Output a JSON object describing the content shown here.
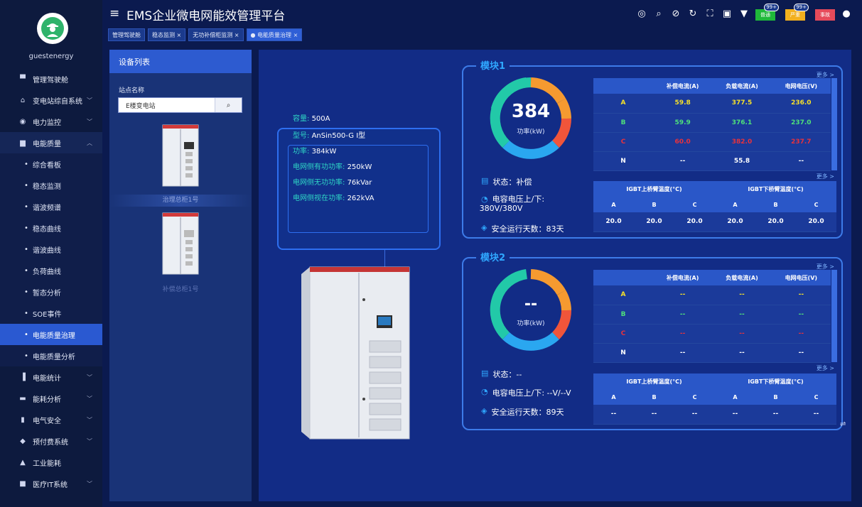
{
  "user": {
    "name": "guestenergy"
  },
  "app": {
    "title": "EMS企业微电网能效管理平台"
  },
  "tabs": [
    {
      "label": "管理驾驶舱"
    },
    {
      "label": "稳态监测 ×"
    },
    {
      "label": "无功补偿柜监测 ×"
    },
    {
      "label": "● 电能质量治理 ×"
    }
  ],
  "alarms": {
    "normal": {
      "label": "普通",
      "count": "99+",
      "color": "#1fb83a"
    },
    "severe": {
      "label": "严重",
      "count": "99+",
      "color": "#f2b01e"
    },
    "fault": {
      "label": "事故",
      "color": "#e64a5a"
    }
  },
  "sidebar": {
    "items": [
      {
        "label": "管理驾驶舱",
        "icon": "monitor-icon"
      },
      {
        "label": "变电站综自系统",
        "icon": "home-icon"
      },
      {
        "label": "电力监控",
        "icon": "gauge-icon"
      },
      {
        "label": "电能质量",
        "icon": "folder-icon"
      }
    ],
    "sub": [
      {
        "label": "综合看板"
      },
      {
        "label": "稳态监测"
      },
      {
        "label": "谐波频谱"
      },
      {
        "label": "稳态曲线"
      },
      {
        "label": "谐波曲线"
      },
      {
        "label": "负荷曲线"
      },
      {
        "label": "暂态分析"
      },
      {
        "label": "SOE事件"
      },
      {
        "label": "电能质量治理"
      },
      {
        "label": "电能质量分析"
      }
    ],
    "bottom": [
      {
        "label": "电能统计",
        "icon": "bar-chart-icon"
      },
      {
        "label": "能耗分析",
        "icon": "analysis-icon"
      },
      {
        "label": "电气安全",
        "icon": "fire-extinguisher-icon"
      },
      {
        "label": "预付费系统",
        "icon": "prepay-icon"
      },
      {
        "label": "工业能耗",
        "icon": "factory-icon"
      },
      {
        "label": "医疗IT系统",
        "icon": "medical-icon"
      }
    ]
  },
  "device_panel": {
    "title": "设备列表",
    "site_label": "站点名称",
    "site_value": "E楼变电站",
    "devices": [
      {
        "label": "治理总柜1号"
      },
      {
        "label": "补偿总柜1号"
      }
    ]
  },
  "device_info": {
    "capacity_k": "容量:",
    "capacity_v": "500A",
    "model_k": "型号:",
    "model_v": "AnSin500-G I型",
    "power_k": "功率:",
    "power_v": "384kW",
    "active_k": "电网侧有功功率:",
    "active_v": "250kW",
    "reactive_k": "电网侧无功功率:",
    "reactive_v": "76kVar",
    "apparent_k": "电网侧视在功率:",
    "apparent_v": "262kVA"
  },
  "modules": [
    {
      "title": "模块1",
      "more": "更多 >",
      "power": "384",
      "power_unit": "功率(kW)",
      "status": "状态：补偿",
      "cap_voltage_1": "电容电压上/下:",
      "cap_voltage_2": "380V/380V",
      "safe_days": "安全运行天数：83天",
      "table_headers": [
        "",
        "补偿电流(A)",
        "负载电流(A)",
        "电网电压(V)"
      ],
      "rows": [
        {
          "phase": "A",
          "comp": "59.8",
          "load": "377.5",
          "volt": "236.0",
          "color": "#f5e02a"
        },
        {
          "phase": "B",
          "comp": "59.9",
          "load": "376.1",
          "volt": "237.0",
          "color": "#4fe07a"
        },
        {
          "phase": "C",
          "comp": "60.0",
          "load": "382.0",
          "volt": "237.7",
          "color": "#e8323c"
        },
        {
          "phase": "N",
          "comp": "--",
          "load": "55.8",
          "volt": "--",
          "color": "#ffffff"
        }
      ],
      "igbt_more": "更多 >",
      "igbt_up": "IGBT上桥臂温度(°C)",
      "igbt_down": "IGBT下桥臂温度(°C)",
      "igbt_cols": [
        "A",
        "B",
        "C",
        "A",
        "B",
        "C"
      ],
      "igbt_vals": [
        "20.0",
        "20.0",
        "20.0",
        "20.0",
        "20.0",
        "20.0"
      ]
    },
    {
      "title": "模块2",
      "more": "更多 >",
      "power": "--",
      "power_unit": "功率(kW)",
      "status": "状态：--",
      "cap_voltage_1": "电容电压上/下: --V/--V",
      "safe_days": "安全运行天数：89天",
      "table_headers": [
        "",
        "补偿电流(A)",
        "负载电流(A)",
        "电网电压(V)"
      ],
      "rows": [
        {
          "phase": "A",
          "comp": "--",
          "load": "--",
          "volt": "--",
          "color": "#f5e02a"
        },
        {
          "phase": "B",
          "comp": "--",
          "load": "--",
          "volt": "--",
          "color": "#4fe07a"
        },
        {
          "phase": "C",
          "comp": "--",
          "load": "--",
          "volt": "--",
          "color": "#e8323c"
        },
        {
          "phase": "N",
          "comp": "--",
          "load": "--",
          "volt": "--",
          "color": "#ffffff"
        }
      ],
      "igbt_more": "更多 >",
      "igbt_up": "IGBT上桥臂温度(°C)",
      "igbt_down": "IGBT下桥臂温度(°C)",
      "igbt_cols": [
        "A",
        "B",
        "C",
        "A",
        "B",
        "C"
      ],
      "igbt_vals": [
        "--",
        "--",
        "--",
        "--",
        "--",
        "--"
      ]
    }
  ],
  "colors": {
    "accent": "#2a59d1",
    "gauge_orange": "#f59a30",
    "gauge_red": "#f0553a",
    "gauge_blue": "#2aa7f0",
    "gauge_teal": "#22c9a8"
  }
}
